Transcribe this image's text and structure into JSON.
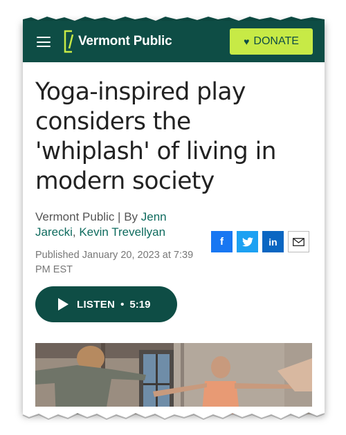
{
  "header": {
    "brand": "Vermont Public",
    "donate_label": "DONATE",
    "menu_icon": "hamburger-icon",
    "donate_icon": "heart-icon",
    "brand_color": "#0e4d45",
    "accent_color": "#c7ea46"
  },
  "article": {
    "headline": "Yoga-inspired play considers the 'whiplash' of living in modern society",
    "byline_prefix": "Vermont Public | By ",
    "author_1": "Jenn Jarecki",
    "author_sep": ", ",
    "author_2": "Kevin Trevellyan",
    "published": "Published January 20, 2023 at 7:39 PM EST"
  },
  "share": {
    "facebook": "f",
    "linkedin": "in",
    "icons": [
      "facebook-icon",
      "twitter-icon",
      "linkedin-icon",
      "email-icon"
    ]
  },
  "audio": {
    "label": "LISTEN",
    "separator": "•",
    "duration": "5:19"
  }
}
